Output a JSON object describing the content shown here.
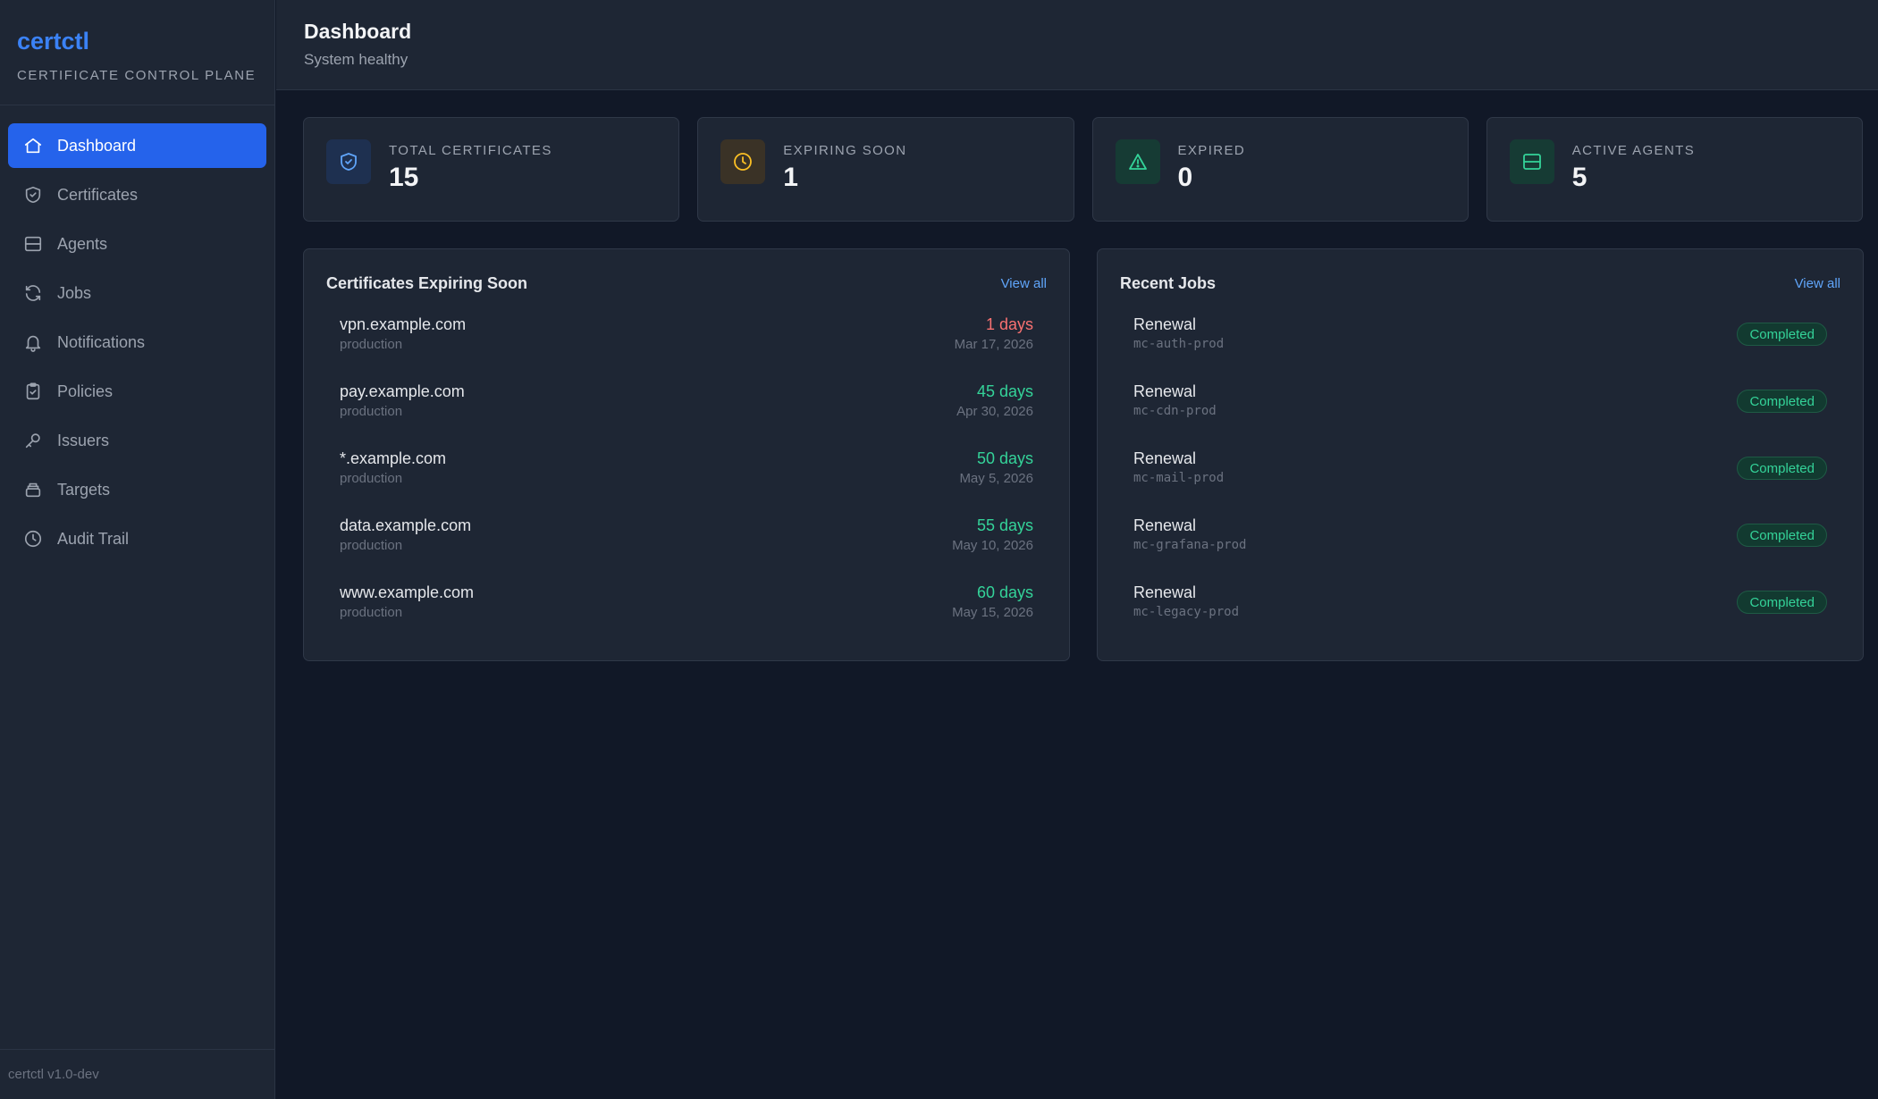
{
  "brand": {
    "name": "certctl",
    "subtitle": "CERTIFICATE CONTROL PLANE"
  },
  "sidebar": {
    "items": [
      {
        "label": "Dashboard",
        "icon": "home-icon",
        "active": true
      },
      {
        "label": "Certificates",
        "icon": "shield-check-icon"
      },
      {
        "label": "Agents",
        "icon": "server-icon"
      },
      {
        "label": "Jobs",
        "icon": "refresh-icon"
      },
      {
        "label": "Notifications",
        "icon": "bell-icon"
      },
      {
        "label": "Policies",
        "icon": "clipboard-check-icon"
      },
      {
        "label": "Issuers",
        "icon": "key-icon"
      },
      {
        "label": "Targets",
        "icon": "target-icon"
      },
      {
        "label": "Audit Trail",
        "icon": "clock-icon"
      }
    ],
    "footer": "certctl v1.0-dev"
  },
  "header": {
    "title": "Dashboard",
    "subtitle": "System healthy"
  },
  "stats": [
    {
      "label": "TOTAL CERTIFICATES",
      "value": "15",
      "icon": "shield-check-icon",
      "color": "#60a5fa"
    },
    {
      "label": "EXPIRING SOON",
      "value": "1",
      "icon": "clock-icon",
      "color": "#fbbf24"
    },
    {
      "label": "EXPIRED",
      "value": "0",
      "icon": "alert-triangle-icon",
      "color": "#34d399"
    },
    {
      "label": "ACTIVE AGENTS",
      "value": "5",
      "icon": "server-icon",
      "color": "#34d399"
    }
  ],
  "expiring": {
    "title": "Certificates Expiring Soon",
    "view_all": "View all",
    "rows": [
      {
        "name": "vpn.example.com",
        "env": "production",
        "days": "1 days",
        "date": "Mar 17, 2026",
        "urgent": true
      },
      {
        "name": "pay.example.com",
        "env": "production",
        "days": "45 days",
        "date": "Apr 30, 2026"
      },
      {
        "name": "*.example.com",
        "env": "production",
        "days": "50 days",
        "date": "May 5, 2026"
      },
      {
        "name": "data.example.com",
        "env": "production",
        "days": "55 days",
        "date": "May 10, 2026"
      },
      {
        "name": "www.example.com",
        "env": "production",
        "days": "60 days",
        "date": "May 15, 2026"
      }
    ]
  },
  "jobs": {
    "title": "Recent Jobs",
    "view_all": "View all",
    "rows": [
      {
        "type": "Renewal",
        "cert": "mc-auth-prod",
        "status": "Completed"
      },
      {
        "type": "Renewal",
        "cert": "mc-cdn-prod",
        "status": "Completed"
      },
      {
        "type": "Renewal",
        "cert": "mc-mail-prod",
        "status": "Completed"
      },
      {
        "type": "Renewal",
        "cert": "mc-grafana-prod",
        "status": "Completed"
      },
      {
        "type": "Renewal",
        "cert": "mc-legacy-prod",
        "status": "Completed"
      }
    ]
  }
}
